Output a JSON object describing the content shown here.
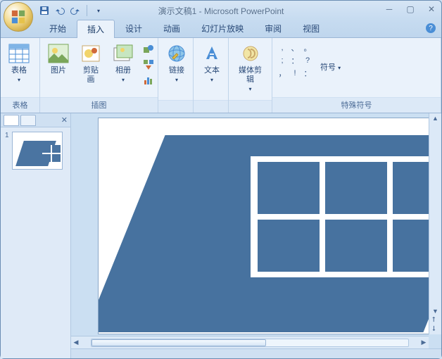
{
  "titlebar": {
    "doc_title": "演示文稿1 - Microsoft PowerPoint"
  },
  "tabs": {
    "items": [
      "开始",
      "插入",
      "设计",
      "动画",
      "幻灯片放映",
      "审阅",
      "视图"
    ],
    "active_index": 1
  },
  "ribbon": {
    "groups": {
      "table": {
        "label": "表格",
        "btn": "表格"
      },
      "illustrations": {
        "label": "插图",
        "picture": "图片",
        "clipart": "剪贴画",
        "album": "相册"
      },
      "links": {
        "label": "",
        "link": "链接"
      },
      "text": {
        "label": "",
        "text": "文本"
      },
      "media": {
        "label": "",
        "media": "媒体剪辑"
      },
      "symbols": {
        "label": "特殊符号",
        "btn": "符号",
        "chars": [
          ",",
          "、",
          "。",
          ";",
          "：",
          "?",
          "，",
          "!",
          "："
        ]
      }
    }
  },
  "sidepanel": {
    "slides": [
      {
        "num": "1"
      }
    ]
  }
}
